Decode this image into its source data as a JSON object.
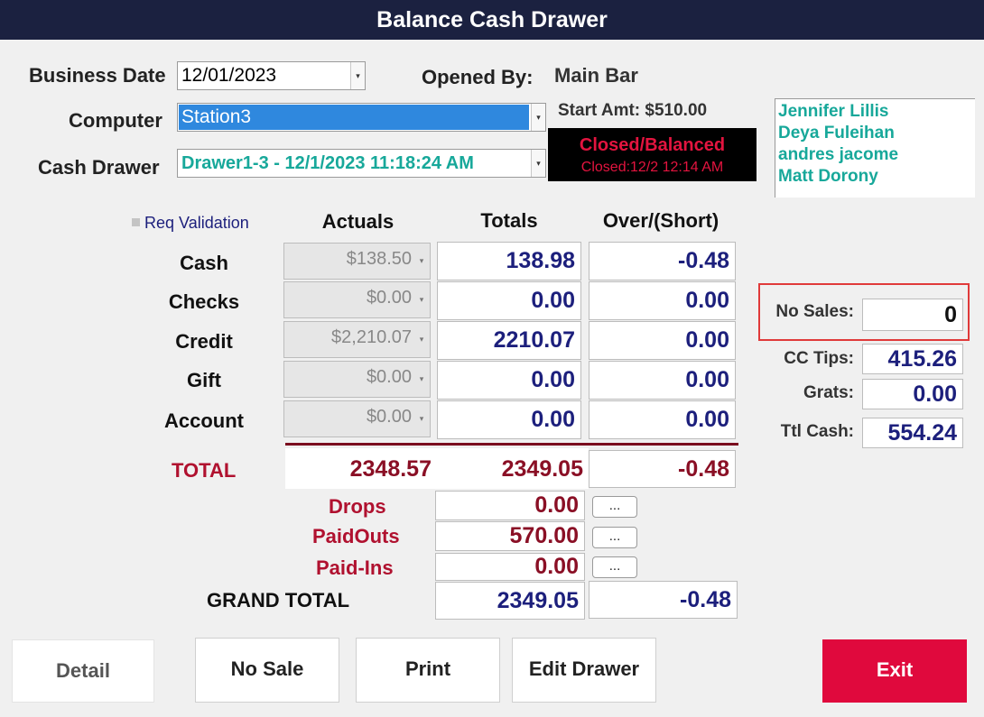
{
  "window": {
    "title": "Balance Cash Drawer"
  },
  "header": {
    "business_date_label": "Business Date",
    "business_date_value": "12/01/2023",
    "opened_by_label": "Opened By:",
    "opened_by_value": "Main Bar",
    "computer_label": "Computer",
    "computer_value": "Station3",
    "start_amt_text": "Start Amt: $510.00",
    "cash_drawer_label": "Cash Drawer",
    "cash_drawer_value": "Drawer1-3 - 12/1/2023 11:18:24 AM",
    "status_main": "Closed/Balanced",
    "status_sub": "Closed:12/2 12:14 AM"
  },
  "users": [
    "Jennifer Lillis",
    "Deya Fuleihan",
    "andres jacome",
    "Matt Dorony"
  ],
  "table": {
    "req_validation_label": "Req Validation",
    "col_actuals": "Actuals",
    "col_totals": "Totals",
    "col_over_short": "Over/(Short)",
    "rows": [
      {
        "label": "Cash",
        "actual": "$138.50",
        "total": "138.98",
        "over": "-0.48"
      },
      {
        "label": "Checks",
        "actual": "$0.00",
        "total": "0.00",
        "over": "0.00"
      },
      {
        "label": "Credit",
        "actual": "$2,210.07",
        "total": "2210.07",
        "over": "0.00"
      },
      {
        "label": "Gift",
        "actual": "$0.00",
        "total": "0.00",
        "over": "0.00"
      },
      {
        "label": "Account",
        "actual": "$0.00",
        "total": "0.00",
        "over": "0.00"
      }
    ],
    "total_label": "TOTAL",
    "total_actual": "2348.57",
    "total_totals": "2349.05",
    "total_over": "-0.48",
    "drops_label": "Drops",
    "drops_value": "0.00",
    "paidouts_label": "PaidOuts",
    "paidouts_value": "570.00",
    "paidins_label": "Paid-Ins",
    "paidins_value": "0.00",
    "ellipsis": "...",
    "grand_total_label": "GRAND TOTAL",
    "grand_total_value": "2349.05",
    "grand_total_over": "-0.48"
  },
  "side": {
    "no_sales_label": "No Sales:",
    "no_sales_value": "0",
    "cc_tips_label": "CC Tips:",
    "cc_tips_value": "415.26",
    "grats_label": "Grats:",
    "grats_value": "0.00",
    "ttl_cash_label": "Ttl Cash:",
    "ttl_cash_value": "554.24"
  },
  "buttons": {
    "detail": "Detail",
    "no_sale": "No Sale",
    "print": "Print",
    "edit_drawer": "Edit Drawer",
    "exit": "Exit"
  },
  "icons": {
    "dropdown": "chevron-down-icon",
    "highlight_color": "#e03a3a",
    "exit_color": "#e0093d"
  }
}
